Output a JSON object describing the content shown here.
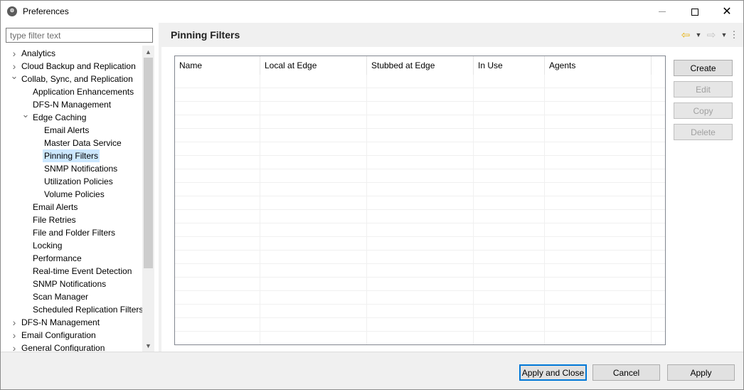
{
  "window": {
    "title": "Preferences"
  },
  "filter": {
    "placeholder": "type filter text",
    "value": ""
  },
  "tree": {
    "items": [
      {
        "label": "Analytics",
        "level": 0,
        "expander": "collapsed"
      },
      {
        "label": "Cloud Backup and Replication",
        "level": 0,
        "expander": "collapsed"
      },
      {
        "label": "Collab, Sync, and Replication",
        "level": 0,
        "expander": "expanded"
      },
      {
        "label": "Application Enhancements",
        "level": 1,
        "expander": "none"
      },
      {
        "label": "DFS-N Management",
        "level": 1,
        "expander": "none"
      },
      {
        "label": "Edge Caching",
        "level": 1,
        "expander": "expanded"
      },
      {
        "label": "Email Alerts",
        "level": 2,
        "expander": "none"
      },
      {
        "label": "Master Data Service",
        "level": 2,
        "expander": "none"
      },
      {
        "label": "Pinning Filters",
        "level": 2,
        "expander": "none",
        "selected": true
      },
      {
        "label": "SNMP Notifications",
        "level": 2,
        "expander": "none"
      },
      {
        "label": "Utilization Policies",
        "level": 2,
        "expander": "none"
      },
      {
        "label": "Volume Policies",
        "level": 2,
        "expander": "none"
      },
      {
        "label": "Email Alerts",
        "level": 1,
        "expander": "none"
      },
      {
        "label": "File Retries",
        "level": 1,
        "expander": "none"
      },
      {
        "label": "File and Folder Filters",
        "level": 1,
        "expander": "none"
      },
      {
        "label": "Locking",
        "level": 1,
        "expander": "none"
      },
      {
        "label": "Performance",
        "level": 1,
        "expander": "none"
      },
      {
        "label": "Real-time Event Detection",
        "level": 1,
        "expander": "none"
      },
      {
        "label": "SNMP Notifications",
        "level": 1,
        "expander": "none"
      },
      {
        "label": "Scan Manager",
        "level": 1,
        "expander": "none"
      },
      {
        "label": "Scheduled Replication Filters",
        "level": 1,
        "expander": "none"
      },
      {
        "label": "DFS-N Management",
        "level": 0,
        "expander": "collapsed"
      },
      {
        "label": "Email Configuration",
        "level": 0,
        "expander": "collapsed"
      },
      {
        "label": "General Configuration",
        "level": 0,
        "expander": "collapsed"
      }
    ]
  },
  "page": {
    "title": "Pinning Filters"
  },
  "table": {
    "columns": [
      "Name",
      "Local at Edge",
      "Stubbed at Edge",
      "In Use",
      "Agents"
    ],
    "rows": []
  },
  "side_buttons": [
    {
      "label": "Create",
      "enabled": true
    },
    {
      "label": "Edit",
      "enabled": false
    },
    {
      "label": "Copy",
      "enabled": false
    },
    {
      "label": "Delete",
      "enabled": false
    }
  ],
  "footer": {
    "apply_close": "Apply and Close",
    "cancel": "Cancel",
    "apply": "Apply"
  },
  "icons": {
    "app": "preferences-app-icon",
    "back": "back-arrow-icon",
    "forward": "forward-arrow-icon",
    "more": "view-menu-icon"
  },
  "colors": {
    "selection": "#cce8ff",
    "back_arrow": "#e7b416",
    "default_button_border": "#0078d7"
  }
}
